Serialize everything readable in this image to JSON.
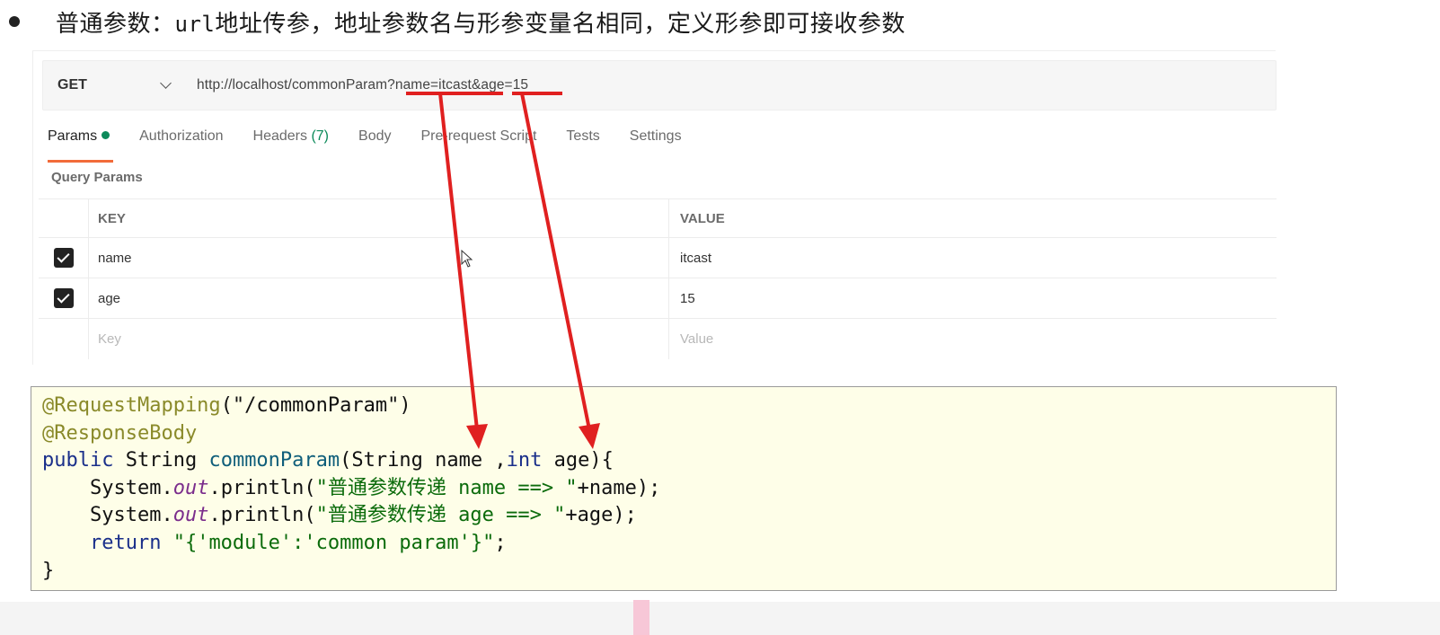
{
  "heading": {
    "prefix": "普通参数：",
    "mono": "url",
    "suffix": "地址传参，地址参数名与形参变量名相同，定义形参即可接收参数"
  },
  "request": {
    "method": "GET",
    "url": "http://localhost/commonParam?name=itcast&age=15"
  },
  "tabs": [
    {
      "label": "Params"
    },
    {
      "label": "Authorization"
    },
    {
      "label": "Headers",
      "count": "(7)"
    },
    {
      "label": "Body"
    },
    {
      "label": "Pre-request Script"
    },
    {
      "label": "Tests"
    },
    {
      "label": "Settings"
    }
  ],
  "query_params": {
    "title": "Query Params",
    "columns": [
      "KEY",
      "VALUE"
    ],
    "rows": [
      {
        "key": "name",
        "value": "itcast",
        "checked": true
      },
      {
        "key": "age",
        "value": "15",
        "checked": true
      }
    ],
    "placeholder_key": "Key",
    "placeholder_value": "Value"
  },
  "code": {
    "l1_ann": "@RequestMapping",
    "l1_rest": "(\"/commonParam\")",
    "l2_ann": "@ResponseBody",
    "l3_kw": "public",
    "l3_a": " String ",
    "l3_fn": "commonParam",
    "l3_b": "(String name ,",
    "l3_kw2": "int",
    "l3_c": " age){",
    "l4_a": "    System.",
    "l4_out": "out",
    "l4_b": ".println(",
    "l4_str": "\"普通参数传递 name ==> \"",
    "l4_c": "+name);",
    "l5_a": "    System.",
    "l5_out": "out",
    "l5_b": ".println(",
    "l5_str": "\"普通参数传递 age ==> \"",
    "l5_c": "+age);",
    "l6_kw": "    return ",
    "l6_str": "\"{'module':'common param'}\"",
    "l6_c": ";",
    "l7": "}"
  },
  "colors": {
    "arrow": "#e02020",
    "tab_underline": "#f26b3a",
    "param_dot": "#0c8a5a",
    "code_bg": "#fefee8"
  }
}
